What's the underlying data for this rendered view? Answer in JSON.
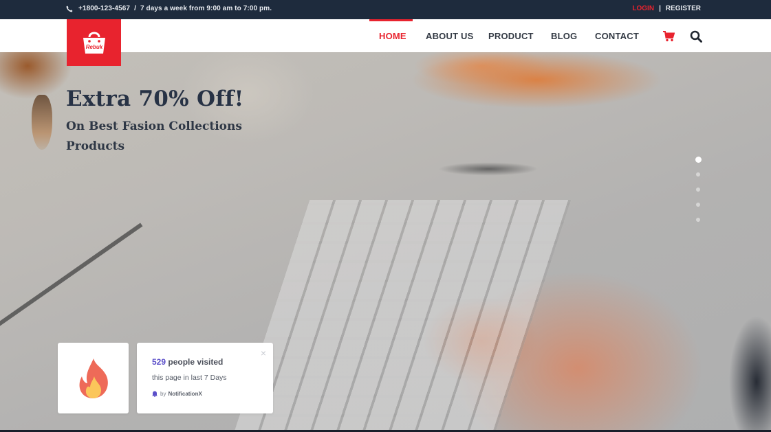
{
  "topbar": {
    "phone_icon": "phone-icon",
    "phone": "+1800-123-4567",
    "separator": "/",
    "hours": "7 days a week from 9:00 am to 7:00 pm.",
    "login": "LOGIN",
    "divider": "|",
    "register": "REGISTER"
  },
  "header": {
    "logo_text": "Rebuk",
    "logo_icon": "shopping-bag-icon",
    "nav": [
      {
        "label": "HOME",
        "active": true
      },
      {
        "label": "ABOUT US",
        "active": false
      },
      {
        "label": "PRODUCT",
        "active": false
      },
      {
        "label": "BLOG",
        "active": false
      },
      {
        "label": "CONTACT",
        "active": false
      }
    ],
    "cart_icon": "cart-icon",
    "search_icon": "search-icon"
  },
  "hero": {
    "title": "Extra 70% Off!",
    "subtitle": "On Best Fasion Collections Products",
    "slides_total": 5,
    "active_slide": 1
  },
  "notification": {
    "icon": "fire-icon",
    "count": "529",
    "line1_suffix": " people visited",
    "line2": "this page in last 7 Days",
    "brand_prefix": "by",
    "brand": "NotificationX",
    "close": "×"
  },
  "colors": {
    "accent": "#e8232e",
    "topbar_bg": "#1e2b3d",
    "notification_accent": "#5b4fc9",
    "heading": "#273245"
  }
}
